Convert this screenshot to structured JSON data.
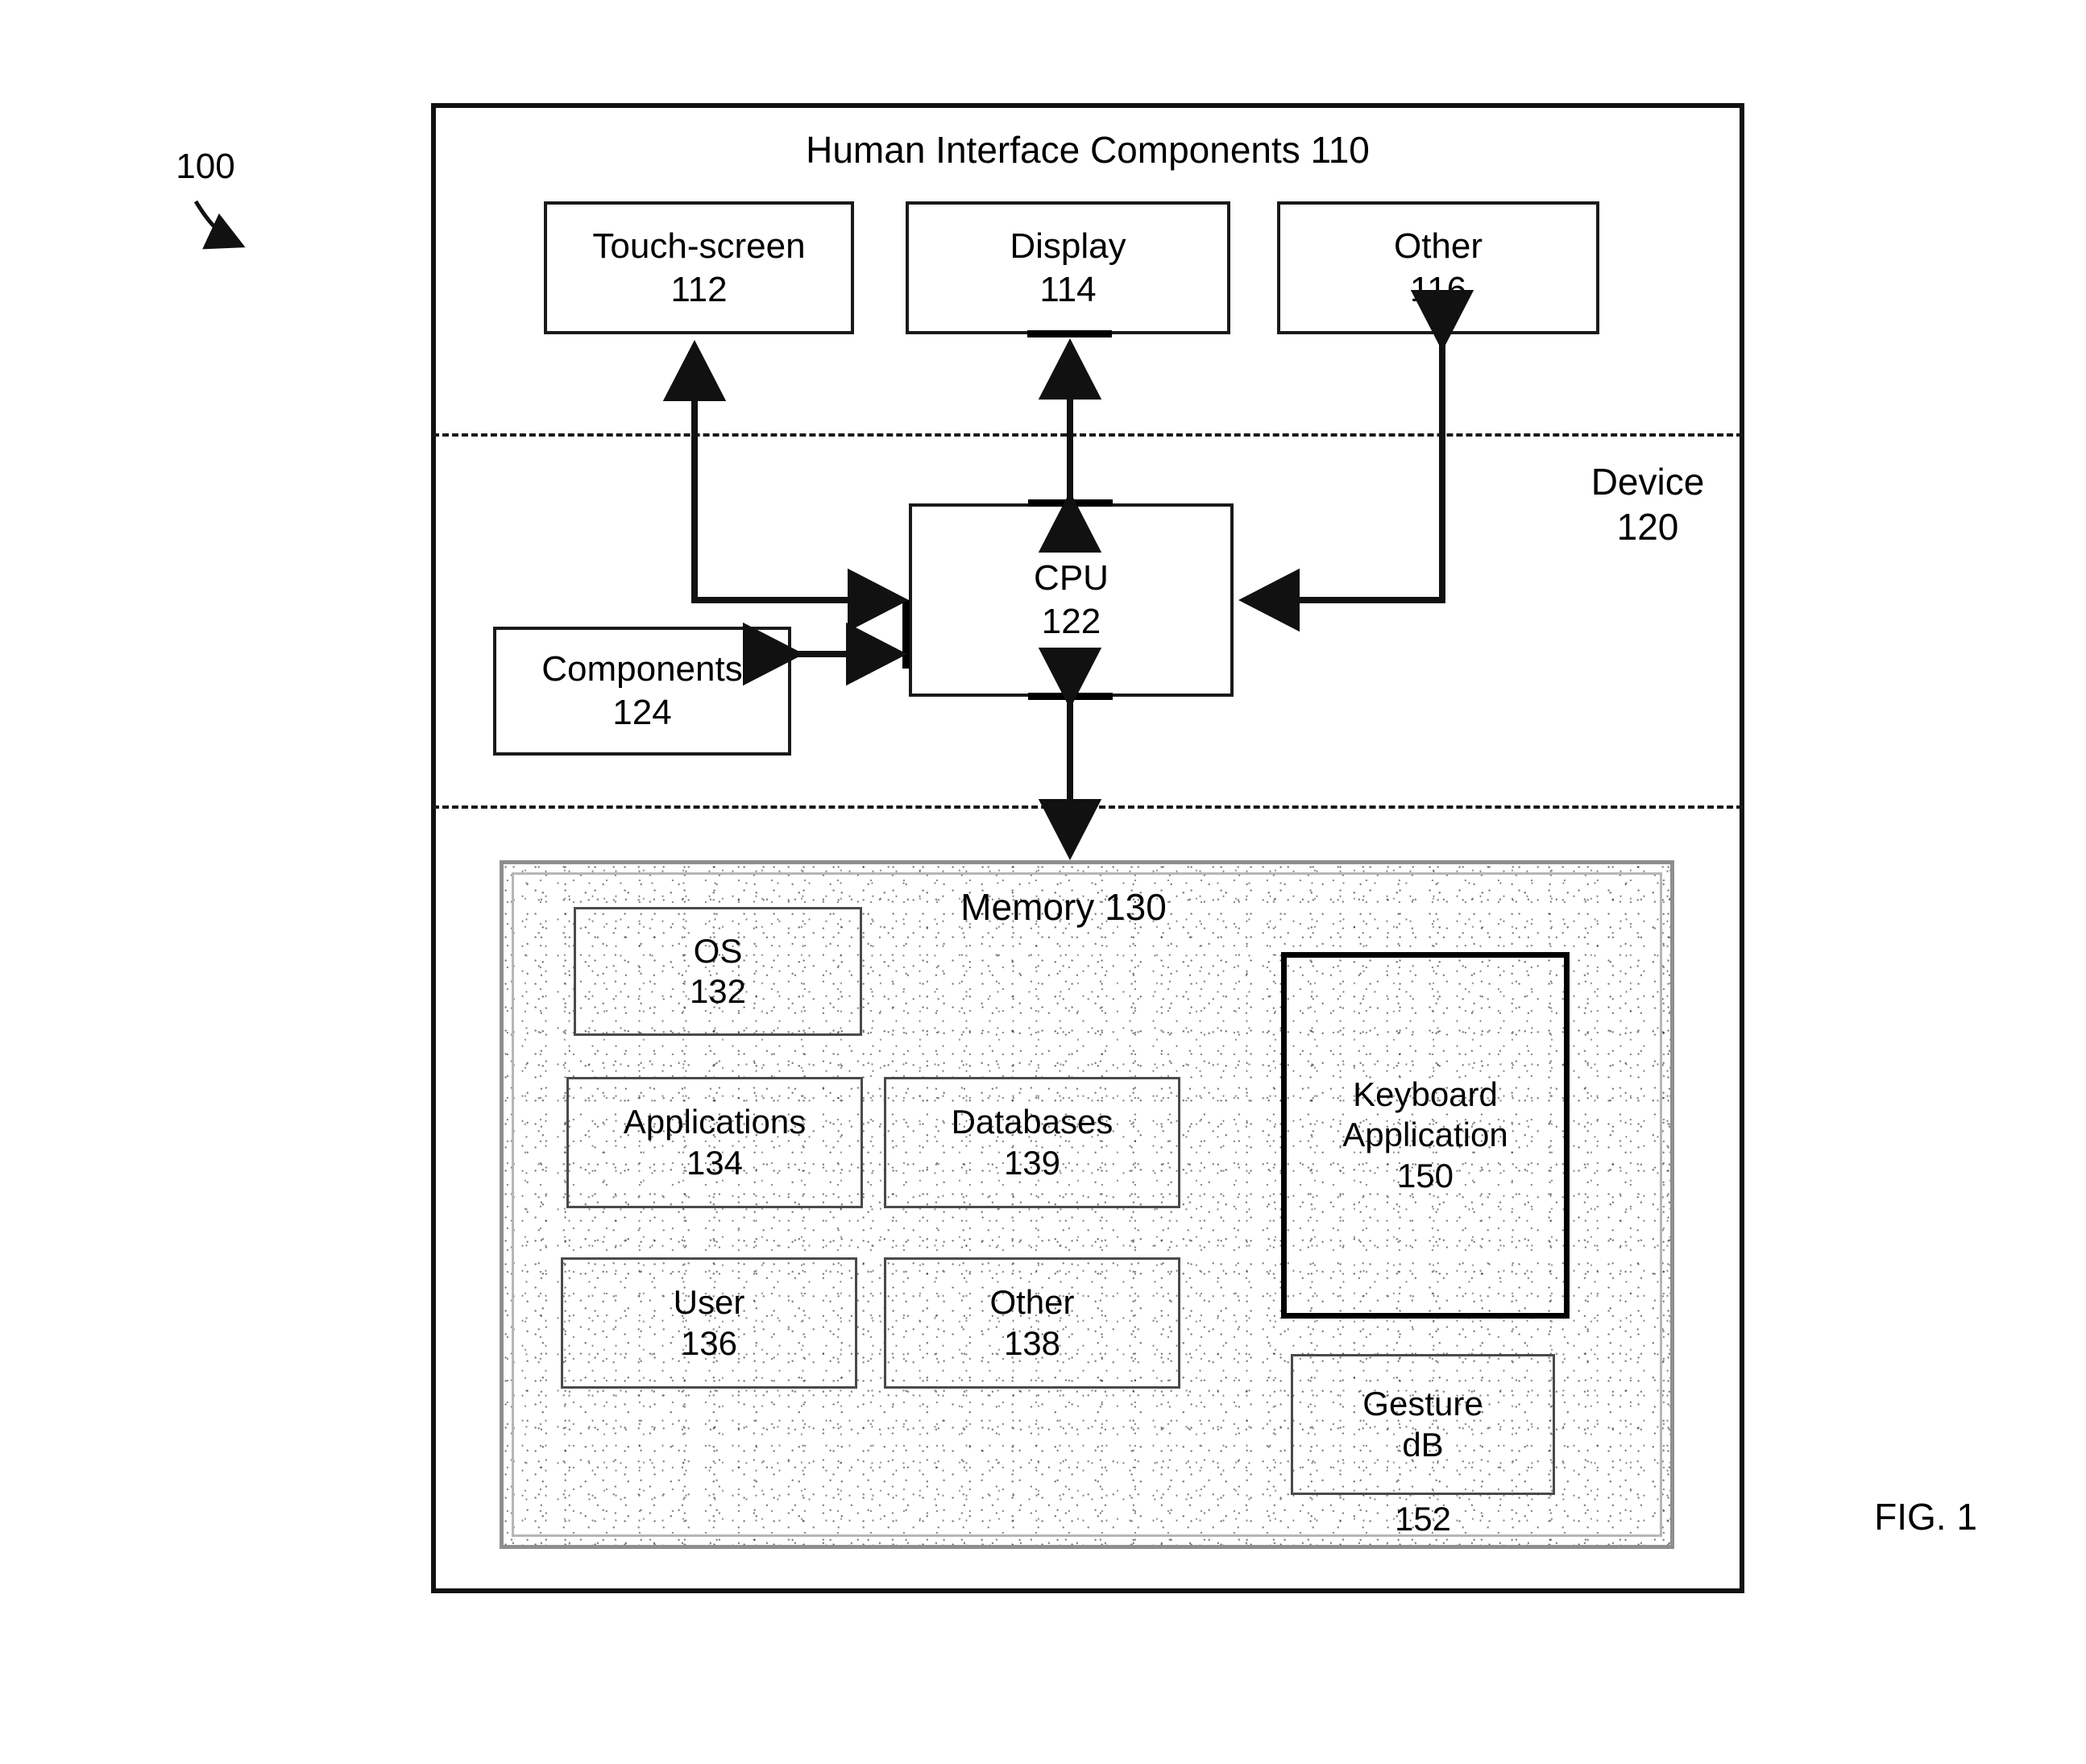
{
  "figure": {
    "number_label": "100",
    "caption": "FIG. 1"
  },
  "device": {
    "label_line1": "Device",
    "label_line2": "120"
  },
  "human_interface": {
    "title": "Human Interface Components 110",
    "components": [
      {
        "name": "Touch-screen",
        "ref": "112"
      },
      {
        "name": "Display",
        "ref": "114"
      },
      {
        "name": "Other",
        "ref": "116"
      }
    ]
  },
  "processor": {
    "name": "CPU",
    "ref": "122"
  },
  "components_block": {
    "name": "Components",
    "ref": "124"
  },
  "memory": {
    "title": "Memory 130",
    "items": [
      {
        "name": "OS",
        "ref": "132"
      },
      {
        "name": "Applications",
        "ref": "134"
      },
      {
        "name": "Databases",
        "ref": "139"
      },
      {
        "name": "User",
        "ref": "136"
      },
      {
        "name": "Other",
        "ref": "138"
      }
    ],
    "keyboard_application": {
      "line1": "Keyboard",
      "line2": "Application",
      "ref": "150"
    },
    "gesture_db": {
      "line1": "Gesture",
      "line2": "dB",
      "ref": "152"
    }
  }
}
